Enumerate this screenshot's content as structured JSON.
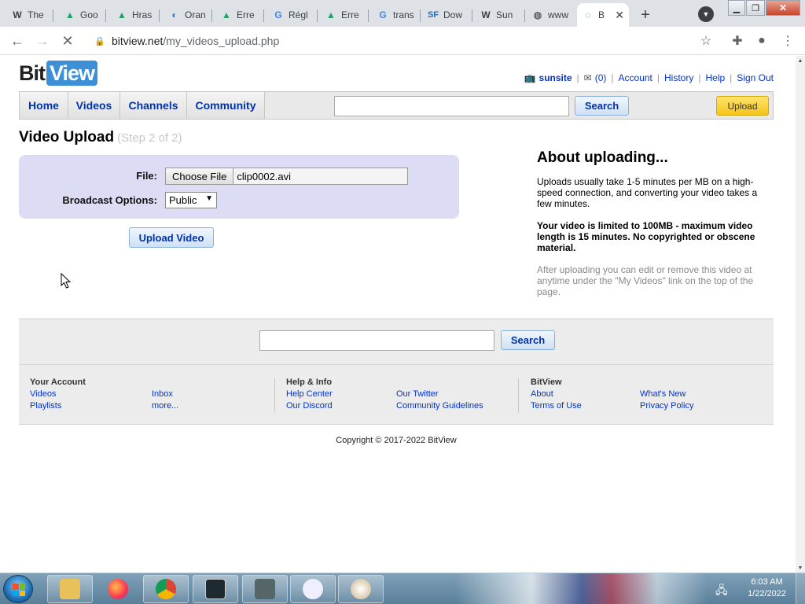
{
  "browser": {
    "tabs": [
      {
        "favicon": "W",
        "label": "The",
        "icon": "wikipedia-icon"
      },
      {
        "favicon": "▲",
        "label": "Goo",
        "icon": "google-drive-icon"
      },
      {
        "favicon": "▲",
        "label": "Hras",
        "icon": "google-drive-icon"
      },
      {
        "favicon": "◐",
        "label": "Oran",
        "icon": "orange-icon"
      },
      {
        "favicon": "▲",
        "label": "Erre",
        "icon": "google-drive-icon"
      },
      {
        "favicon": "G",
        "label": "Régl",
        "icon": "google-icon"
      },
      {
        "favicon": "▲",
        "label": "Erre",
        "icon": "google-drive-icon"
      },
      {
        "favicon": "G",
        "label": "trans",
        "icon": "google-icon"
      },
      {
        "favicon": "SF",
        "label": "Dow",
        "icon": "sourceforge-icon"
      },
      {
        "favicon": "W",
        "label": "Sun",
        "icon": "wikipedia-icon"
      },
      {
        "favicon": "◍",
        "label": "www",
        "icon": "globe-icon"
      },
      {
        "favicon": "◌",
        "label": "B",
        "icon": "loading-icon"
      }
    ],
    "url_host": "bitview.net",
    "url_path": "/my_videos_upload.php"
  },
  "site": {
    "logo_bit": "Bit",
    "logo_view": "View",
    "user": {
      "username": "sunsite",
      "inbox_count": "(0)",
      "links": [
        "Account",
        "History",
        "Help",
        "Sign Out"
      ]
    },
    "nav": [
      "Home",
      "Videos",
      "Channels",
      "Community"
    ],
    "search_button": "Search",
    "upload_button": "Upload"
  },
  "upload": {
    "title": "Video Upload",
    "step": "(Step 2 of 2)",
    "file_label": "File:",
    "choose_file": "Choose File",
    "file_name": "clip0002.avi",
    "broadcast_label": "Broadcast Options:",
    "broadcast_value": "Public",
    "submit": "Upload Video"
  },
  "about": {
    "heading": "About uploading...",
    "p1": "Uploads usually take 1-5 minutes per MB on a high-speed connection, and converting your video takes a few minutes.",
    "p2": "Your video is limited to 100MB - maximum video length is 15 minutes. No copyrighted or obscene material.",
    "p3": "After uploading you can edit or remove this video at anytime under the \"My Videos\" link on the top of the page."
  },
  "footer": {
    "search_button": "Search",
    "your_account": {
      "head": "Your Account",
      "links": [
        "Videos",
        "Playlists",
        "Inbox",
        "more..."
      ]
    },
    "help_info": {
      "head": "Help & Info",
      "links": [
        "Help Center",
        "Our Discord",
        "Our Twitter",
        "Community Guidelines"
      ]
    },
    "bitview": {
      "head": "BitView",
      "links": [
        "About",
        "Terms of Use",
        "What's New",
        "Privacy Policy"
      ]
    },
    "copyright": "Copyright © 2017-2022 BitView"
  },
  "taskbar": {
    "time": "6:03 AM",
    "date": "1/22/2022"
  }
}
